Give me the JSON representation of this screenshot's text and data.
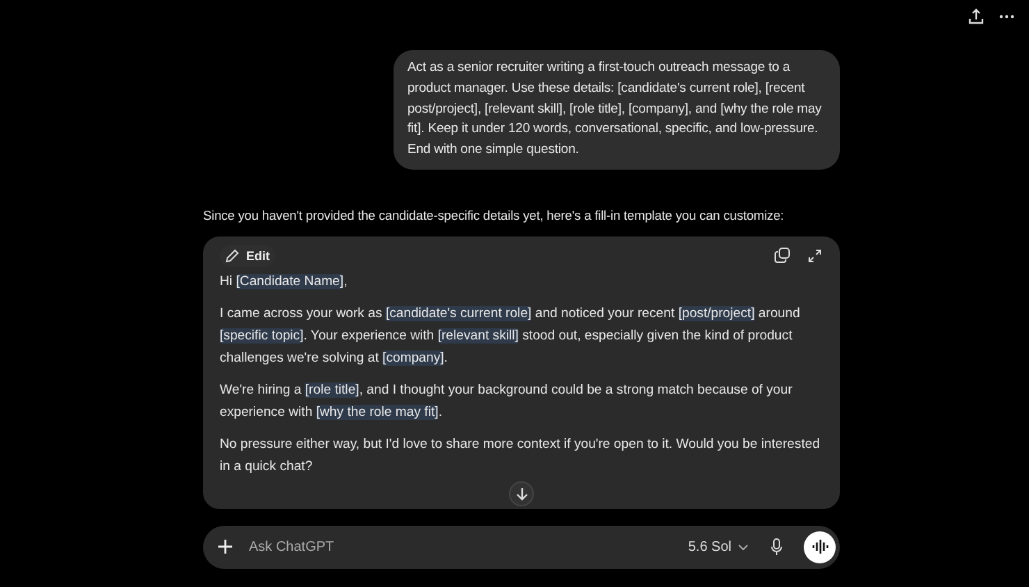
{
  "user_message": "Act as a senior recruiter writing a first-touch outreach message to a product manager. Use these details: [candidate's current role], [recent post/project], [relevant skill], [role title], [company], and [why the role may fit]. Keep it under 120 words, conversational, specific, and low-pressure. End with one simple question.",
  "assistant_intro": "Since you haven't provided the candidate-specific details yet, here's a fill-in template you can customize:",
  "template_card": {
    "edit_label": "Edit",
    "paragraphs": [
      [
        {
          "text": "Hi ",
          "placeholder": false
        },
        {
          "text": "[Candidate Name]",
          "placeholder": true
        },
        {
          "text": ",",
          "placeholder": false
        }
      ],
      [
        {
          "text": "I came across your work as ",
          "placeholder": false
        },
        {
          "text": "[candidate's current role]",
          "placeholder": true
        },
        {
          "text": " and noticed your recent ",
          "placeholder": false
        },
        {
          "text": "[post/project]",
          "placeholder": true
        },
        {
          "text": " around ",
          "placeholder": false
        },
        {
          "text": "[specific topic]",
          "placeholder": true
        },
        {
          "text": ". Your experience with ",
          "placeholder": false
        },
        {
          "text": "[relevant skill]",
          "placeholder": true
        },
        {
          "text": " stood out, especially given the kind of product challenges we're solving at ",
          "placeholder": false
        },
        {
          "text": "[company]",
          "placeholder": true
        },
        {
          "text": ".",
          "placeholder": false
        }
      ],
      [
        {
          "text": "We're hiring a ",
          "placeholder": false
        },
        {
          "text": "[role title]",
          "placeholder": true
        },
        {
          "text": ", and I thought your background could be a strong match because of your experience with ",
          "placeholder": false
        },
        {
          "text": "[why the role may fit]",
          "placeholder": true
        },
        {
          "text": ".",
          "placeholder": false
        }
      ],
      [
        {
          "text": "No pressure either way, but I'd love to share more context if you're open to it. Would you be interested in a quick chat?",
          "placeholder": false
        }
      ]
    ]
  },
  "composer": {
    "placeholder": "Ask ChatGPT",
    "model": "5.6 Sol"
  }
}
